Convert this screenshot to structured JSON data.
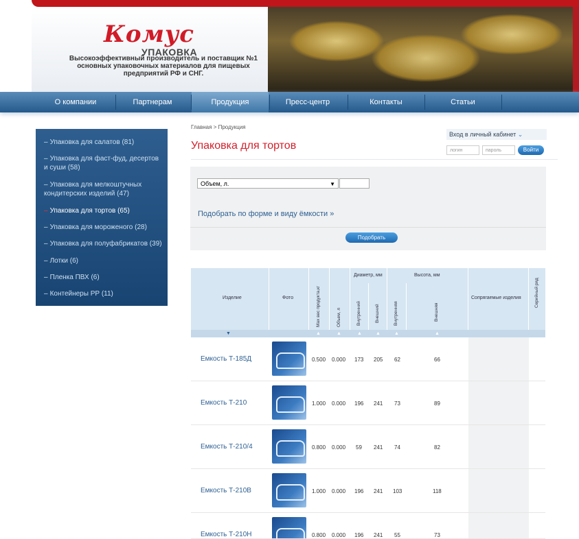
{
  "brand": {
    "logo": "Комус",
    "upakovka": "УПАКОВКА",
    "tagline": "Высокоэффективный производитель и поставщик №1 основных упаковочных материалов для пищевых предприятий РФ и СНГ."
  },
  "nav": [
    {
      "label": "О компании"
    },
    {
      "label": "Партнерам"
    },
    {
      "label": "Продукция"
    },
    {
      "label": "Пресс-центр"
    },
    {
      "label": "Контакты"
    },
    {
      "label": "Статьи"
    }
  ],
  "sidebar": {
    "items": [
      {
        "label": "Упаковка для салатов (81)"
      },
      {
        "label": "Упаковка для фаст-фуд, десертов и суши (58)"
      },
      {
        "label": "Упаковка для мелкоштучных кондитерских изделий (47)"
      },
      {
        "label": "Упаковка для тортов (65)"
      },
      {
        "label": "Упаковка для мороженого (28)"
      },
      {
        "label": "Упаковка для полуфабрикатов (39)"
      },
      {
        "label": "Лотки (6)"
      },
      {
        "label": "Пленка ПВХ (6)"
      },
      {
        "label": "Контейнеры РР (11)"
      }
    ]
  },
  "breadcrumb": {
    "home": "Главная",
    "sep": ">",
    "current": "Продукция"
  },
  "page_title": "Упаковка для тортов",
  "login": {
    "title": "Вход в личный кабинет",
    "login_placeholder": "логин",
    "password_placeholder": "пароль",
    "button": "Войти"
  },
  "filter": {
    "select_value": "Объем, л.",
    "link": "Подобрать по форме и виду ёмкости",
    "link_chevron": "»",
    "button": "Подобрать"
  },
  "table": {
    "headers": {
      "item": "Изделие",
      "photo": "Фото",
      "max_weight": "Max вес продукта,кг",
      "volume": "Объем, л",
      "diameter": "Диаметр, мм",
      "inner_d": "Внутренний",
      "outer_d": "Внешний",
      "height": "Высота, мм",
      "inner_h": "Внутренняя",
      "outer_h": "Внешняя",
      "related": "Сопрягаемые изделия",
      "serial": "Серийный ряд"
    },
    "rows": [
      {
        "name": "Емкость Т-185Д",
        "max_weight": "0.500",
        "volume": "0.000",
        "inner_d": "173",
        "outer_d": "205",
        "inner_h": "62",
        "outer_h": "66"
      },
      {
        "name": "Емкость Т-210",
        "max_weight": "1.000",
        "volume": "0.000",
        "inner_d": "196",
        "outer_d": "241",
        "inner_h": "73",
        "outer_h": "89"
      },
      {
        "name": "Емкость Т-210/4",
        "max_weight": "0.800",
        "volume": "0.000",
        "inner_d": "59",
        "outer_d": "241",
        "inner_h": "74",
        "outer_h": "82"
      },
      {
        "name": "Емкость Т-210В",
        "max_weight": "1.000",
        "volume": "0.000",
        "inner_d": "196",
        "outer_d": "241",
        "inner_h": "103",
        "outer_h": "118"
      },
      {
        "name": "Емкость Т-210Н",
        "max_weight": "0.800",
        "volume": "0.000",
        "inner_d": "196",
        "outer_d": "241",
        "inner_h": "55",
        "outer_h": "73"
      }
    ]
  },
  "colors": {
    "accent_red": "#d21e2a",
    "nav_blue": "#245a8c",
    "link_blue": "#2d5f93"
  }
}
